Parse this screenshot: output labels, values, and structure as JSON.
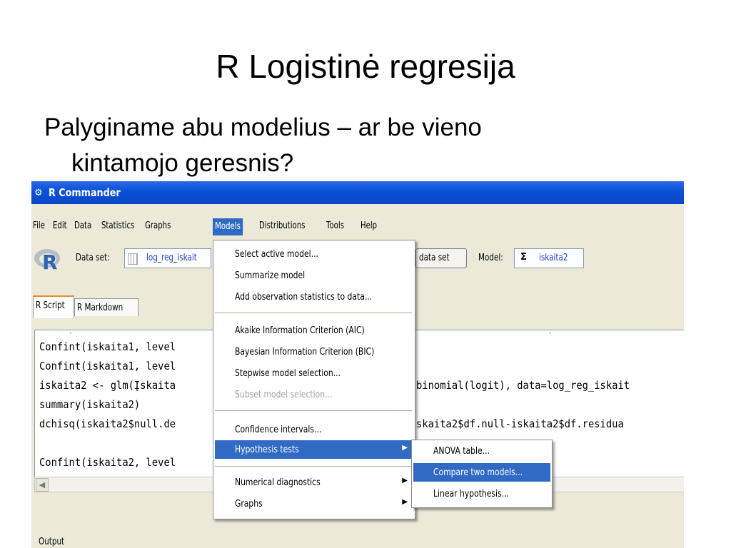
{
  "slide": {
    "title": "R Logistinė regresija",
    "body_line1": "Palyginame abu modelius – ar be vieno",
    "body_line2": "kintamojo geresnis?"
  },
  "window": {
    "title": "R Commander",
    "menubar": [
      "File",
      "Edit",
      "Data",
      "Statistics",
      "Graphs",
      "Models",
      "Distributions",
      "Tools",
      "Help"
    ],
    "active_menu": "Models"
  },
  "toolbar": {
    "dataset_label": "Data set:",
    "dataset_value": "log_reg_iskait",
    "view_button": "data set",
    "model_label": "Model:",
    "model_value": "iskaita2"
  },
  "tabs": [
    "R Script",
    "R Markdown"
  ],
  "script_lines": [
    "Confint(iskaita1, level",
    "Confint(iskaita1, level",
    "iskaita2 <- glm(Įskaita",
    "summary(iskaita2)",
    "dchisq(iskaita2$null.de",
    "",
    "Confint(iskaita2, level"
  ],
  "script_lines_right": [
    "",
    "",
    "binomial(logit), data=log_reg_iskait",
    "",
    "skaita2$df.null-iskaita2$df.residua",
    "",
    ""
  ],
  "output_label": "Output",
  "models_menu": {
    "items": [
      "Select active model...",
      "Summarize model",
      "Add observation statistics to data...",
      "Akaike Information Criterion (AIC)",
      "Bayesian Information Criterion (BIC)",
      "Stepwise model selection...",
      "Subset model selection...",
      "Confidence intervals...",
      "Hypothesis tests",
      "Numerical diagnostics",
      "Graphs"
    ]
  },
  "hypothesis_submenu": {
    "items": [
      "ANOVA table...",
      "Compare two models...",
      "Linear hypothesis..."
    ]
  },
  "colors": {
    "titlebar": "#0a47c6",
    "highlight": "#316ac5",
    "window_bg": "#ece9d8"
  }
}
